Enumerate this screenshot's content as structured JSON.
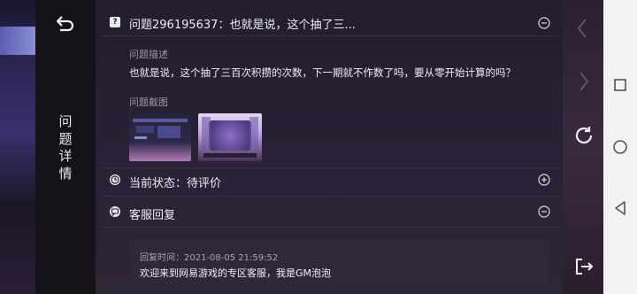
{
  "header": {
    "vertical_title": "问题详情"
  },
  "question": {
    "title": "问题296195637：也就是说，这个抽了三...",
    "description_label": "问题描述",
    "description_text": "也就是说，这个抽了三百次积攒的次数，下一期就不作数了吗，要从零开始计算的吗？",
    "screenshot_label": "问题截图"
  },
  "status": {
    "label": "当前状态：待评价"
  },
  "service": {
    "label": "客服回复",
    "reply_time": "回复时间：2021-08-05 21:59:52",
    "reply_text": "欢迎来到网易游戏的专区客服，我是GM泡泡"
  },
  "colors": {
    "accent": "#e8e8ee",
    "panel": "#231d2e"
  }
}
